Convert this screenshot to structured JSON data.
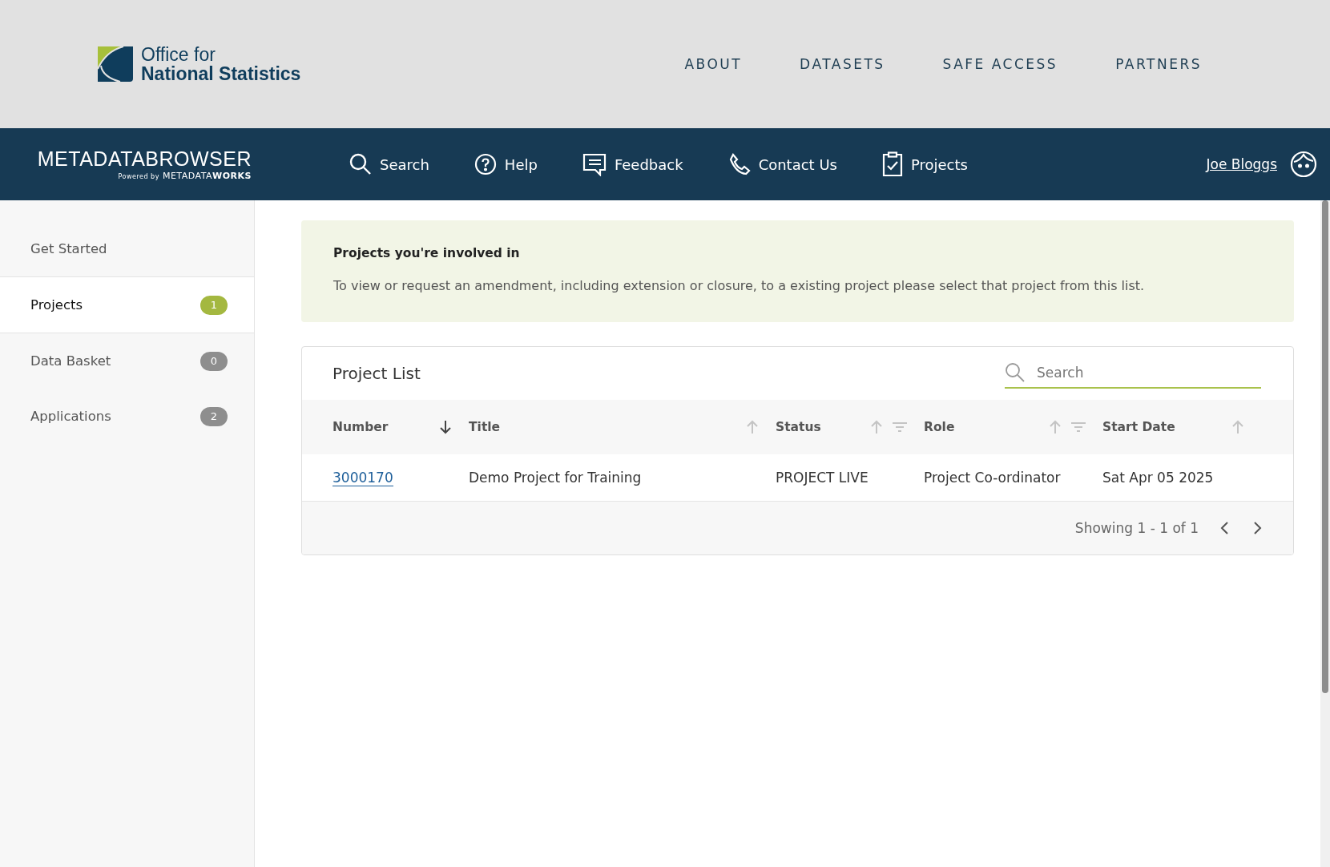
{
  "header": {
    "logo_lines": [
      "Office for",
      "National Statistics"
    ],
    "nav": [
      "ABOUT",
      "DATASETS",
      "SAFE ACCESS",
      "PARTNERS"
    ]
  },
  "toolbar": {
    "brand_light": "METADATA",
    "brand_bold": "BROWSER",
    "powered_by": "Powered by",
    "brand2_light": "METADATA",
    "brand2_bold": "WORKS",
    "items": [
      {
        "kind": "search",
        "label": "Search"
      },
      {
        "kind": "help",
        "label": "Help"
      },
      {
        "kind": "feedback",
        "label": "Feedback"
      },
      {
        "kind": "contact",
        "label": "Contact Us"
      },
      {
        "kind": "projects",
        "label": "Projects"
      }
    ],
    "user": "Joe Bloggs"
  },
  "sidebar": {
    "items": [
      {
        "label": "Get Started",
        "selected": false
      },
      {
        "label": "Projects",
        "selected": true,
        "count": "1"
      },
      {
        "label": "Data Basket",
        "selected": false,
        "count": "0"
      },
      {
        "label": "Applications",
        "selected": false,
        "count": "2"
      }
    ]
  },
  "notice": {
    "title": "Projects you're involved in",
    "text": "To view or request an amendment, including extension or closure, to a existing project please select that project from this list."
  },
  "project_list": {
    "title": "Project List",
    "search": {
      "placeholder": "Search"
    },
    "columns": [
      {
        "label": "Number",
        "sorted_descending": true,
        "filter": false
      },
      {
        "label": "Title",
        "sorted_descending": false,
        "filter": false
      },
      {
        "label": "Status",
        "sorted_descending": false,
        "filter": true
      },
      {
        "label": "Role",
        "sorted_descending": false,
        "filter": true
      },
      {
        "label": "Start Date",
        "sorted_descending": false,
        "filter": false
      }
    ],
    "rows": [
      {
        "number": "3000170",
        "title": "Demo Project for Training",
        "status": "PROJECT LIVE",
        "role": "Project Co-ordinator",
        "start_date": "Sat Apr 05 2025"
      }
    ],
    "pagination": "Showing 1 - 1 of 1"
  }
}
